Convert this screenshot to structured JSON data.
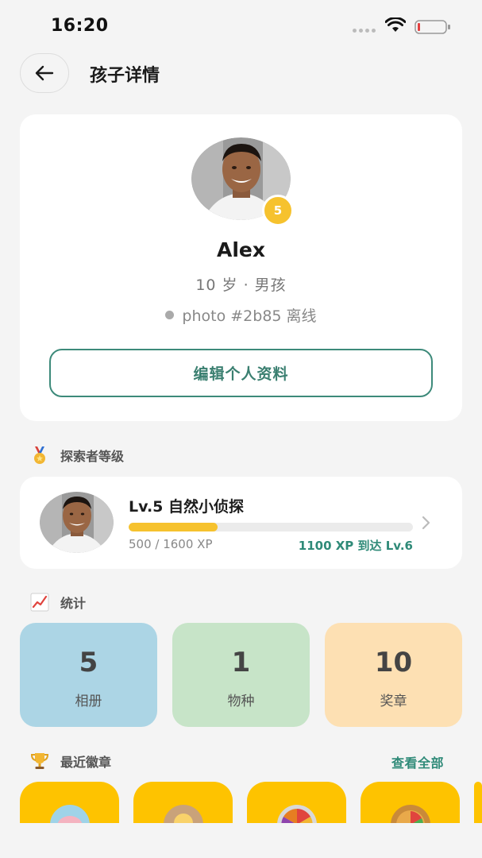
{
  "status_bar": {
    "time": "16:20"
  },
  "header": {
    "title": "孩子详情"
  },
  "profile": {
    "name": "Alex",
    "level_badge": "5",
    "info": "10 岁 · 男孩",
    "device_status": "photo #2b85 离线",
    "edit_button": "编辑个人资料"
  },
  "level_section": {
    "label": "探索者等级",
    "title": "Lv.5 自然小侦探",
    "xp_current": "500 / 1600 XP",
    "xp_remaining": "1100 XP 到达 Lv.6",
    "progress_fraction": 0.3125
  },
  "stats_section": {
    "label": "统计",
    "tiles": [
      {
        "value": "5",
        "label": "相册",
        "color": "#acd5e5"
      },
      {
        "value": "1",
        "label": "物种",
        "color": "#c7e4c8"
      },
      {
        "value": "10",
        "label": "奖章",
        "color": "#fde0b3"
      }
    ]
  },
  "badges_section": {
    "label": "最近徽章",
    "view_all": "查看全部",
    "badge_color": "#fec300"
  },
  "colors": {
    "accent": "#3a7f70",
    "xp_bar": "#f6c22e",
    "background": "#f4f4f4"
  }
}
